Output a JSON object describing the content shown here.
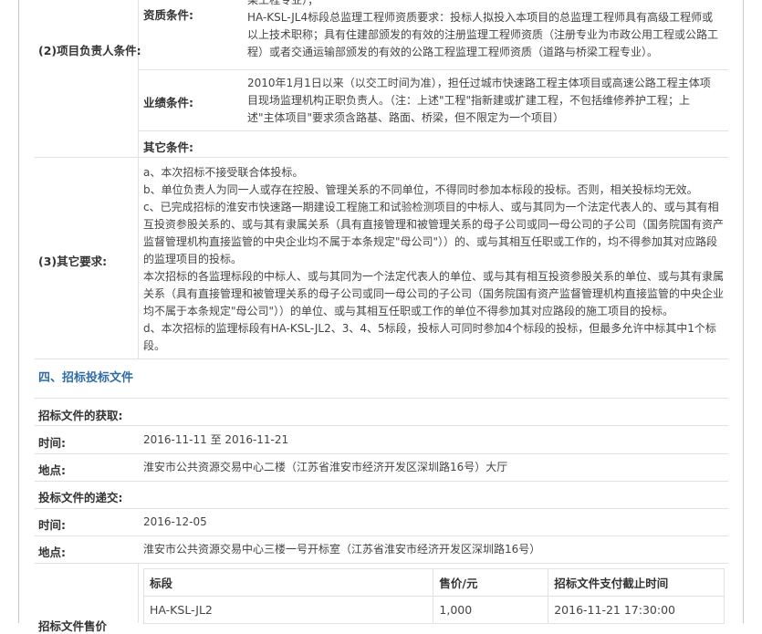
{
  "project_leader": {
    "label": "(2)项目负责人条件:",
    "qualification_label": "资质条件:",
    "qualification_lines": [
      "梁工程专业）；",
      "HA-KSL-JL4标段总监理工程师资质要求：投标人拟投入本项目的总监理工程师具有高级工程师或",
      "以上技术职称；具有住建部颁发的有效的注册监理工程师资质（注册专业为市政公用工程或公路工",
      "程）或者交通运输部颁发的有效的公路工程监理工程师资质（道路与桥梁工程专业）。"
    ],
    "performance_label": "业绩条件:",
    "performance_lines": [
      "2010年1月1日以来（以交工时间为准），担任过城市快速路工程主体项目或高速公路工程主体项",
      "目现场监理机构正职负责人。（注：上述\"工程\"指新建或扩建工程，不包括维修养护工程；上",
      "述\"主体项目\"要求须含路基、路面、桥梁，但不限定为一个项目）"
    ],
    "other_label": "其它条件:"
  },
  "other_requirements": {
    "label": "(3)其它要求:",
    "lines": [
      "a、本次招标不接受联合体投标。",
      "b、单位负责人为同一人或存在控股、管理关系的不同单位，不得同时参加本标段的投标。否则，相关投标均无效。",
      "c、已完成招标的淮安市快速路一期建设工程施工和试验检测项目的中标人、或与其同为一个法定代表人的、或与其有相",
      "互投资参股关系的、或与其有隶属关系（具有直接管理和被管理关系的母子公司或同一母公司的子公司（国务院国有资产",
      "监督管理机构直接监管的中央企业均不属于本条规定\"母公司\"））的、或与其相互任职或工作的，均不得参加其对应路段",
      "的监理项目的投标。",
      "本次招标的各监理标段的中标人、或与其同为一个法定代表人的单位、或与其有相互投资参股关系的单位、或与其有隶属",
      "关系（具有直接管理和被管理关系的母子公司或同一母公司的子公司（国务院国有资产监督管理机构直接监管的中央企业",
      "均不属于本条规定\"母公司\"））的单位、或与其相互任职或工作的单位不得参加其对应路段的施工项目的投标。",
      "d、本次招标的监理标段有HA-KSL-JL2、3、4、5标段，投标人可同时参加4个标段的投标，但最多允许中标其中1个标",
      "段。"
    ]
  },
  "section4": {
    "title": "四、招标投标文件",
    "acquire": {
      "label": "招标文件的获取:",
      "time_label": "时间:",
      "time_start": "2016-11-11",
      "time_sep": "至",
      "time_end": "2016-11-21",
      "place_label": "地点:",
      "place": "淮安市公共资源交易中心二楼（江苏省淮安市经济开发区深圳路16号）大厅"
    },
    "submit": {
      "label": "投标文件的递交:",
      "time_label": "时间:",
      "time": "2016-12-05",
      "place_label": "地点:",
      "place": "淮安市公共资源交易中心三楼一号开标室（江苏省淮安市经济开发区深圳路16号）"
    },
    "price_label": "招标文件售价",
    "price_table": {
      "headers": [
        "标段",
        "售价/元",
        "招标文件支付截止时间"
      ],
      "rows": [
        [
          "HA-KSL-JL2",
          "1,000",
          "2016-11-21 17:30:00"
        ]
      ]
    }
  }
}
